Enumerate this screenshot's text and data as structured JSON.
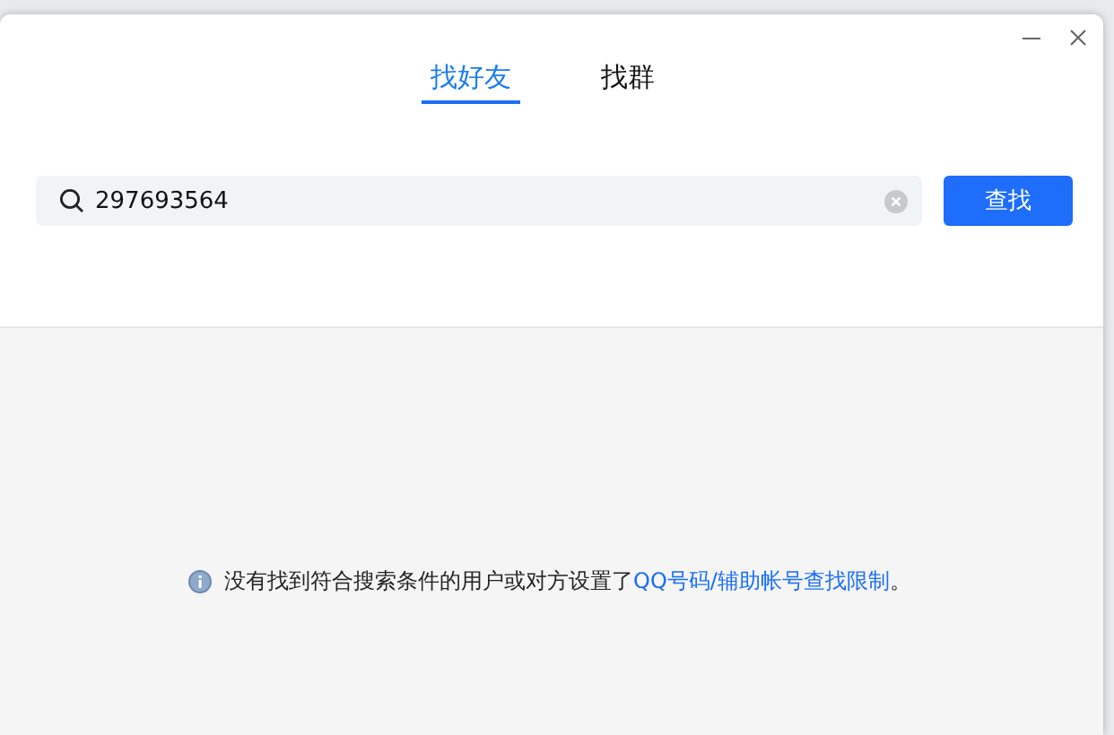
{
  "tabs": [
    {
      "label": "找好友",
      "selected": true
    },
    {
      "label": "找群",
      "selected": false
    }
  ],
  "search": {
    "value": "297693564"
  },
  "search_button": "查找",
  "notice": {
    "text": "没有找到符合搜索条件的用户或对方设置了",
    "link": "QQ号码/辅助帐号查找限制",
    "end": "。"
  }
}
